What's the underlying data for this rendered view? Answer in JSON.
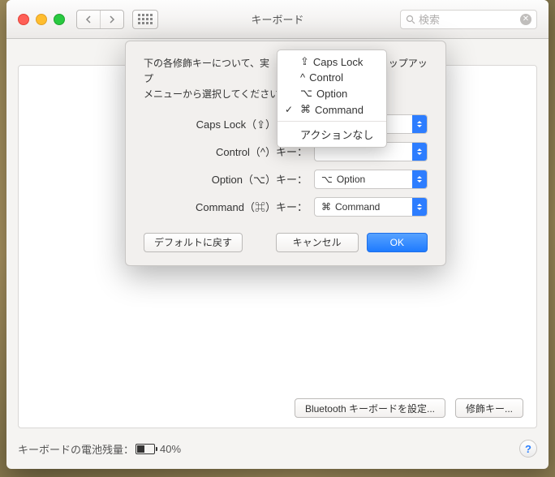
{
  "window": {
    "title": "キーボード"
  },
  "search": {
    "placeholder": "検索"
  },
  "sheet": {
    "intro_l1": "下の各修飾キーについて、実",
    "intro_l1_end": "ップアップ",
    "intro_l2": "メニューから選択してください",
    "rows": {
      "capslock": {
        "label": "Caps Lock（⇪）キー："
      },
      "control": {
        "label": "Control（^）キー："
      },
      "option": {
        "label": "Option（⌥）キー：",
        "value_sym": "⌥",
        "value_txt": "Option"
      },
      "command": {
        "label": "Command（⌘）キー：",
        "value_sym": "⌘",
        "value_txt": "Command"
      }
    },
    "restore_defaults": "デフォルトに戻す",
    "cancel": "キャンセル",
    "ok": "OK"
  },
  "menu": {
    "items": {
      "caps": {
        "sym": "⇪",
        "txt": "Caps Lock"
      },
      "control": {
        "sym": "^",
        "txt": "Control"
      },
      "option": {
        "sym": "⌥",
        "txt": "Option"
      },
      "command": {
        "sym": "⌘",
        "txt": "Command",
        "checked": "✓"
      },
      "noaction": {
        "txt": "アクションなし"
      }
    }
  },
  "body_buttons": {
    "bluetooth": "Bluetooth キーボードを設定...",
    "modifier": "修飾キー..."
  },
  "footer": {
    "label": "キーボードの電池残量：",
    "pct": "40%"
  }
}
